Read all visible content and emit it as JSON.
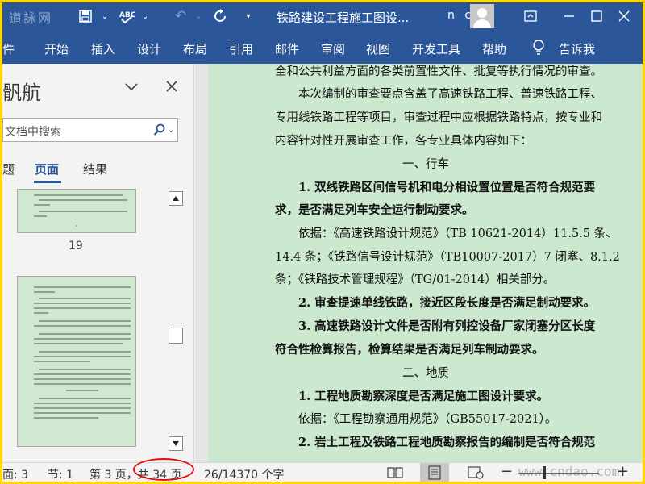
{
  "titlebar": {
    "watermark_logo": "道詠网",
    "doc_title": "铁路建设工程施工图设...",
    "user_name": "n c"
  },
  "ribbon": {
    "tabs": [
      "件",
      "开始",
      "插入",
      "设计",
      "布局",
      "引用",
      "邮件",
      "审阅",
      "视图",
      "开发工具",
      "帮助"
    ],
    "tell_me": "告诉我"
  },
  "nav": {
    "title": "骪航",
    "search_placeholder": "文档中搜索",
    "tabs": [
      "题",
      "页面",
      "结果"
    ],
    "thumb_19_label": "19"
  },
  "document": {
    "lines": [
      "全和公共利益方面的各类前置性文件、批复等执行情况的审查。",
      "本次编制的审查要点含盖了高速铁路工程、普速铁路工程、",
      "专用线铁路工程等项目，审查过程中应根据铁路特点，按专业和",
      "内容针对性开展审查工作，各专业具体内容如下：",
      "一、行车",
      "1. 双线铁路区间信号机和电分相设置位置是否符合规范要",
      "求，是否满足列车安全运行制动要求。",
      "依据：《高速铁路设计规范》（TB 10621-2014）11.5.5 条、",
      "14.4 条；《铁路信号设计规范》（TB10007-2017）7 闭塞、8.1.2",
      "条；《铁路技术管理规程》（TG/01-2014）相关部分。",
      "2. 审查提速单线铁路，接近区段长度是否满足制动要求。",
      "3. 高速铁路设计文件是否附有列控设备厂家闭塞分区长度",
      "符合性检算报告，检算结果是否满足列车制动要求。",
      "二、地质",
      "1. 工程地质勘察深度是否满足施工图设计要求。",
      "依据：《工程勘察通用规范》（GB55017-2021）。",
      "2. 岩土工程及铁路工程地质勘察报告的编制是否符合规范"
    ]
  },
  "status": {
    "page": "面: 3",
    "section": "节: 1",
    "page_of": "第 3 页，共 34 页",
    "words": "26/14370 个字"
  },
  "watermark": "www.cndao.com",
  "colors": {
    "ribbon": "#2b579a",
    "page_bg": "#cce8cf",
    "border_highlight": "#ffd800",
    "annotation_circle": "#e01010"
  }
}
